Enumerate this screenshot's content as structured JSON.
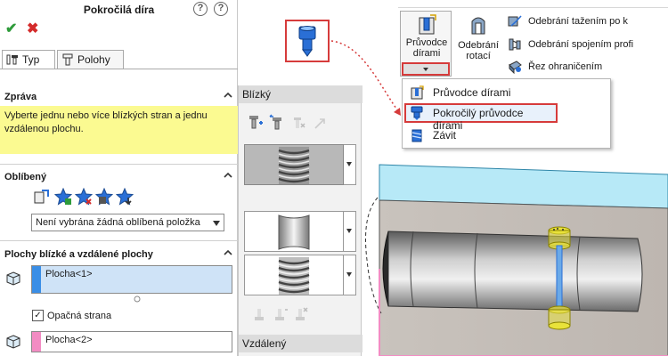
{
  "property_manager": {
    "title": "Pokročilá díra",
    "tabs": [
      {
        "label": "Typ"
      },
      {
        "label": "Polohy"
      }
    ],
    "message": {
      "header": "Zpráva",
      "text": "Vyberte jednu nebo více blízkých stran a jednu vzdálenou plochu."
    },
    "favorites": {
      "header": "Oblíbený",
      "selected": "Není vybrána žádná oblíbená položka"
    },
    "faces": {
      "header": "Plochy blízké a vzdálené plochy",
      "near_face": "Plocha<1>",
      "opposite_label": "Opačná strana",
      "opposite_checked": "✓",
      "far_face": "Plocha<2>"
    }
  },
  "middle_panel": {
    "near_header": "Blízký",
    "far_header": "Vzdálený"
  },
  "ribbon": {
    "hole_wizard_line1": "Průvodce",
    "hole_wizard_line2": "dírami",
    "revolved_cut_line1": "Odebrání",
    "revolved_cut_line2": "rotací",
    "small_buttons": [
      "Odebrání tažením po k",
      "Odebrání spojením profi",
      "Řez ohraničením"
    ]
  },
  "dropdown_menu": {
    "items": [
      "Průvodce dírami",
      "Pokročilý průvodce dírami",
      "Závit"
    ]
  },
  "colors": {
    "accent_red": "#d63b3b",
    "message_bg": "#fbfa91",
    "near_face_swatch": "#3a8ee6",
    "far_face_swatch": "#f28cc3",
    "model_top": "#b7e9f7",
    "feature_yellow": "#e9e23a"
  }
}
